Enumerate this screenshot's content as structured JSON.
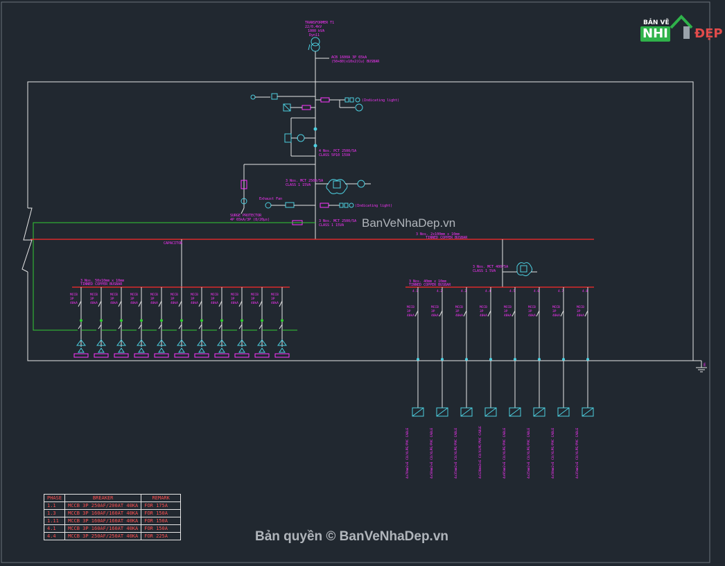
{
  "title_block": {
    "transformer_lines": [
      "TRANSFORMER T1",
      "22/0.4kV",
      "1000 kVA",
      "Dyn11"
    ],
    "main_breaker": [
      "ACB 1600A 3P 65kA",
      "(50+80)x10x2(Cu) BUSBAR"
    ]
  },
  "labels": {
    "indicating_light_top": "(Indicating light)",
    "indicating_light_mid": "(Indicating light)",
    "ct_note_1": "4 Nos. PCT 2500/5A",
    "ct_note_1b": "CLASS 5P10 15VA",
    "ct_note_2": "3 Nos. MCT 2500/5A",
    "ct_note_2b": "CLASS 1 15VA",
    "ct_note_3": "3 Nos. MCT 2500/5A",
    "ct_note_3b": "CLASS 1 15VA",
    "surge_protector": [
      "SURGE PROTECTOR",
      "4P 65kA/3P (8/20μs)"
    ],
    "exhaust_fan": "Exhaust Fan",
    "busbar_main": "3 Nos. 2x100mm x 10mm",
    "busbar_main_b": "TINNED COPPER BUSBAR",
    "busbar_left": "3 Nos. 50x10mm x 10mm",
    "busbar_left_b": "TINNED COPPER BUSBAR",
    "busbar_right": "3 Nos. 40mm x 10mm",
    "busbar_right_b": "TINNED COPPER BUSBAR",
    "earth_label": "E",
    "capacitor_label": "CAPACITOR",
    "small_ct": [
      "3 Nos. MCT 400/5A",
      "CLASS 1 5VA"
    ]
  },
  "left_feeders": {
    "count": 11,
    "breaker": [
      "MCCB",
      "3P",
      "40kA"
    ],
    "cap": "CAPACITOR"
  },
  "right_feeders": {
    "tags": [
      "4.1",
      "4.2",
      "4.3",
      "4.4",
      "4.5",
      "4.6",
      "4.7",
      "4.8"
    ],
    "breaker": [
      "MCCB",
      "3P",
      "40kA"
    ]
  },
  "cable_notes": [
    "4x70mm2+E CU/XLPE/PVC CABLE",
    "4x50mm2+E CU/XLPE/PVC CABLE",
    "4x35mm2+E CU/XLPE/PVC CABLE",
    "4x120mm2+E CU/XLPE/PVC CABLE",
    "4x95mm2+E CU/XLPE/PVC CABLE",
    "4x25mm2+E CU/XLPE/PVC CABLE",
    "4x50mm2+E CU/XLPE/PVC CABLE",
    "4x35mm2+E CU/XLPE/PVC CABLE"
  ],
  "breaker_table": {
    "headers": [
      "PHASE",
      "BREAKER",
      "REMARK"
    ],
    "rows": [
      [
        "1.1",
        "MCCB 3P 250AF/200AT 40KA",
        "FOR 175A"
      ],
      [
        "1.3",
        "MCCB 3P 160AF/160AT 40KA",
        "FOR 150A"
      ],
      [
        "1.11",
        "MCCB 3P 160AF/160AT 40KA",
        "FOR 150A"
      ],
      [
        "4.1",
        "MCCB 3P 160AF/160AT 40KA",
        "FOR 150A"
      ],
      [
        "4.4",
        "MCCB 3P 250AF/250AT 40KA",
        "FOR 225A"
      ]
    ]
  },
  "logo": {
    "ban_ve": "BẢN VẼ",
    "nhi": "NHI",
    "dep": "ĐẸP"
  },
  "watermarks": {
    "center": "BanVeNhaDep.vn",
    "bottom": "Bản quyền © BanVeNhaDep.vn"
  },
  "colors": {
    "background": "#212830",
    "frame": "#e8e8e8",
    "busbar": "#ff2a2a",
    "earth": "#33cc33",
    "device": "#4dd0e1",
    "text": "#ff33ff"
  }
}
